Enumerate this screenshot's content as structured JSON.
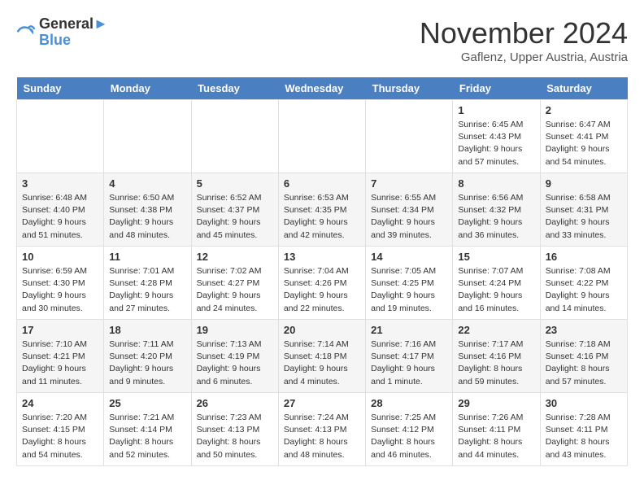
{
  "logo": {
    "line1": "General",
    "line2": "Blue"
  },
  "title": "November 2024",
  "location": "Gaflenz, Upper Austria, Austria",
  "weekdays": [
    "Sunday",
    "Monday",
    "Tuesday",
    "Wednesday",
    "Thursday",
    "Friday",
    "Saturday"
  ],
  "weeks": [
    [
      {
        "day": "",
        "info": ""
      },
      {
        "day": "",
        "info": ""
      },
      {
        "day": "",
        "info": ""
      },
      {
        "day": "",
        "info": ""
      },
      {
        "day": "",
        "info": ""
      },
      {
        "day": "1",
        "info": "Sunrise: 6:45 AM\nSunset: 4:43 PM\nDaylight: 9 hours and 57 minutes."
      },
      {
        "day": "2",
        "info": "Sunrise: 6:47 AM\nSunset: 4:41 PM\nDaylight: 9 hours and 54 minutes."
      }
    ],
    [
      {
        "day": "3",
        "info": "Sunrise: 6:48 AM\nSunset: 4:40 PM\nDaylight: 9 hours and 51 minutes."
      },
      {
        "day": "4",
        "info": "Sunrise: 6:50 AM\nSunset: 4:38 PM\nDaylight: 9 hours and 48 minutes."
      },
      {
        "day": "5",
        "info": "Sunrise: 6:52 AM\nSunset: 4:37 PM\nDaylight: 9 hours and 45 minutes."
      },
      {
        "day": "6",
        "info": "Sunrise: 6:53 AM\nSunset: 4:35 PM\nDaylight: 9 hours and 42 minutes."
      },
      {
        "day": "7",
        "info": "Sunrise: 6:55 AM\nSunset: 4:34 PM\nDaylight: 9 hours and 39 minutes."
      },
      {
        "day": "8",
        "info": "Sunrise: 6:56 AM\nSunset: 4:32 PM\nDaylight: 9 hours and 36 minutes."
      },
      {
        "day": "9",
        "info": "Sunrise: 6:58 AM\nSunset: 4:31 PM\nDaylight: 9 hours and 33 minutes."
      }
    ],
    [
      {
        "day": "10",
        "info": "Sunrise: 6:59 AM\nSunset: 4:30 PM\nDaylight: 9 hours and 30 minutes."
      },
      {
        "day": "11",
        "info": "Sunrise: 7:01 AM\nSunset: 4:28 PM\nDaylight: 9 hours and 27 minutes."
      },
      {
        "day": "12",
        "info": "Sunrise: 7:02 AM\nSunset: 4:27 PM\nDaylight: 9 hours and 24 minutes."
      },
      {
        "day": "13",
        "info": "Sunrise: 7:04 AM\nSunset: 4:26 PM\nDaylight: 9 hours and 22 minutes."
      },
      {
        "day": "14",
        "info": "Sunrise: 7:05 AM\nSunset: 4:25 PM\nDaylight: 9 hours and 19 minutes."
      },
      {
        "day": "15",
        "info": "Sunrise: 7:07 AM\nSunset: 4:24 PM\nDaylight: 9 hours and 16 minutes."
      },
      {
        "day": "16",
        "info": "Sunrise: 7:08 AM\nSunset: 4:22 PM\nDaylight: 9 hours and 14 minutes."
      }
    ],
    [
      {
        "day": "17",
        "info": "Sunrise: 7:10 AM\nSunset: 4:21 PM\nDaylight: 9 hours and 11 minutes."
      },
      {
        "day": "18",
        "info": "Sunrise: 7:11 AM\nSunset: 4:20 PM\nDaylight: 9 hours and 9 minutes."
      },
      {
        "day": "19",
        "info": "Sunrise: 7:13 AM\nSunset: 4:19 PM\nDaylight: 9 hours and 6 minutes."
      },
      {
        "day": "20",
        "info": "Sunrise: 7:14 AM\nSunset: 4:18 PM\nDaylight: 9 hours and 4 minutes."
      },
      {
        "day": "21",
        "info": "Sunrise: 7:16 AM\nSunset: 4:17 PM\nDaylight: 9 hours and 1 minute."
      },
      {
        "day": "22",
        "info": "Sunrise: 7:17 AM\nSunset: 4:16 PM\nDaylight: 8 hours and 59 minutes."
      },
      {
        "day": "23",
        "info": "Sunrise: 7:18 AM\nSunset: 4:16 PM\nDaylight: 8 hours and 57 minutes."
      }
    ],
    [
      {
        "day": "24",
        "info": "Sunrise: 7:20 AM\nSunset: 4:15 PM\nDaylight: 8 hours and 54 minutes."
      },
      {
        "day": "25",
        "info": "Sunrise: 7:21 AM\nSunset: 4:14 PM\nDaylight: 8 hours and 52 minutes."
      },
      {
        "day": "26",
        "info": "Sunrise: 7:23 AM\nSunset: 4:13 PM\nDaylight: 8 hours and 50 minutes."
      },
      {
        "day": "27",
        "info": "Sunrise: 7:24 AM\nSunset: 4:13 PM\nDaylight: 8 hours and 48 minutes."
      },
      {
        "day": "28",
        "info": "Sunrise: 7:25 AM\nSunset: 4:12 PM\nDaylight: 8 hours and 46 minutes."
      },
      {
        "day": "29",
        "info": "Sunrise: 7:26 AM\nSunset: 4:11 PM\nDaylight: 8 hours and 44 minutes."
      },
      {
        "day": "30",
        "info": "Sunrise: 7:28 AM\nSunset: 4:11 PM\nDaylight: 8 hours and 43 minutes."
      }
    ]
  ]
}
